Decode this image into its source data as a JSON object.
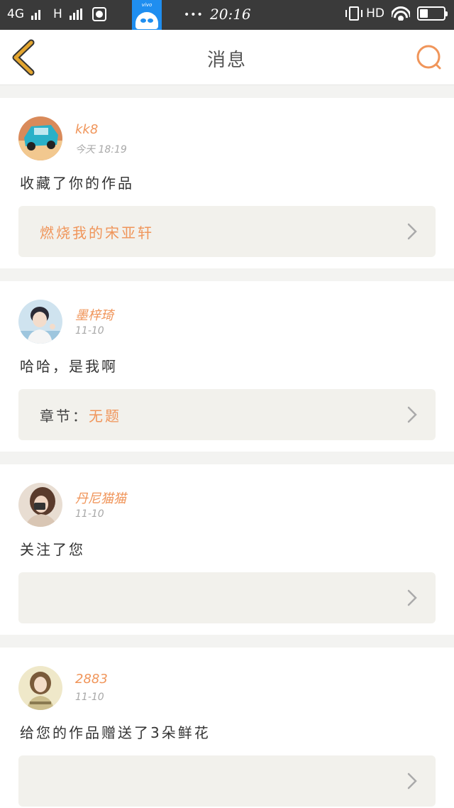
{
  "status_bar": {
    "network_1": "4G",
    "network_2": "H",
    "time": "20:16",
    "dots": "•••",
    "hd": "HD",
    "vivo_label": "vivo",
    "battery_level": 0.35
  },
  "header": {
    "title": "消息"
  },
  "messages": [
    {
      "username": "kk8",
      "time": "今天 18:19",
      "text": "收藏了你的作品",
      "attachment_prefix": "",
      "attachment_title": "燃烧我的宋亚轩"
    },
    {
      "username": "墨梓琦",
      "time": "11-10",
      "text": "哈哈，是我啊",
      "attachment_prefix": "章节：",
      "attachment_title": "无题"
    },
    {
      "username": "丹尼猫猫",
      "time": "11-10",
      "text": "关注了您",
      "attachment_prefix": "",
      "attachment_title": ""
    },
    {
      "username": "2883",
      "time": "11-10",
      "text": "给您的作品赠送了3朵鲜花",
      "attachment_prefix": "",
      "attachment_title": ""
    }
  ],
  "colors": {
    "accent": "#f0955a",
    "back_icon": "#e3a52f",
    "background": "#f3f3f1"
  }
}
